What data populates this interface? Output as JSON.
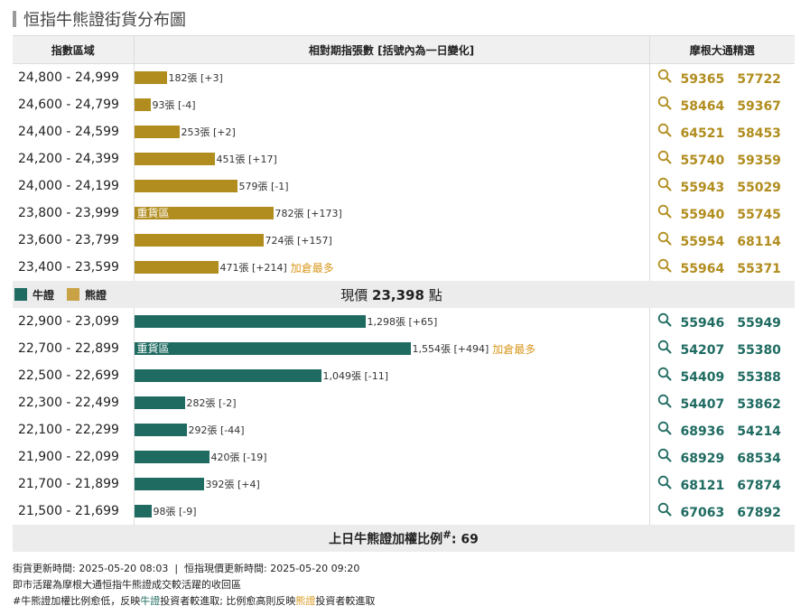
{
  "title": "恒指牛熊證街貨分布圖",
  "colors": {
    "bull": "#1f6b61",
    "bear": "#b18d1f",
    "hot": "#d9981e"
  },
  "header": {
    "col1": "指數區域",
    "col2": "相對期指張數 [括號內為一日變化]",
    "col3": "摩根大通精選"
  },
  "bear_rows": [
    {
      "range": "24,800 - 24,999",
      "qty": 182,
      "label": "182張 [+3]",
      "tag": "",
      "extra": "",
      "codes": [
        "59365",
        "57722"
      ]
    },
    {
      "range": "24,600 - 24,799",
      "qty": 93,
      "label": "93張 [-4]",
      "tag": "",
      "extra": "",
      "codes": [
        "58464",
        "59367"
      ]
    },
    {
      "range": "24,400 - 24,599",
      "qty": 253,
      "label": "253張 [+2]",
      "tag": "",
      "extra": "",
      "codes": [
        "64521",
        "58453"
      ]
    },
    {
      "range": "24,200 - 24,399",
      "qty": 451,
      "label": "451張 [+17]",
      "tag": "",
      "extra": "",
      "codes": [
        "55740",
        "59359"
      ]
    },
    {
      "range": "24,000 - 24,199",
      "qty": 579,
      "label": "579張 [-1]",
      "tag": "",
      "extra": "",
      "codes": [
        "55943",
        "55029"
      ]
    },
    {
      "range": "23,800 - 23,999",
      "qty": 782,
      "label": "782張 [+173]",
      "tag": "重貨區",
      "extra": "",
      "codes": [
        "55940",
        "55745"
      ]
    },
    {
      "range": "23,600 - 23,799",
      "qty": 724,
      "label": "724張 [+157]",
      "tag": "",
      "extra": "",
      "codes": [
        "55954",
        "68114"
      ]
    },
    {
      "range": "23,400 - 23,599",
      "qty": 471,
      "label": "471張 [+214]",
      "tag": "",
      "extra": "加倉最多",
      "codes": [
        "55964",
        "55371"
      ]
    }
  ],
  "legend": {
    "bull": "牛證",
    "bear": "熊證"
  },
  "price": {
    "label": "現價",
    "value": "23,398",
    "unit": "點"
  },
  "bull_rows": [
    {
      "range": "22,900 - 23,099",
      "qty": 1298,
      "label": "1,298張 [+65]",
      "tag": "",
      "extra": "",
      "codes": [
        "55946",
        "55949"
      ]
    },
    {
      "range": "22,700 - 22,899",
      "qty": 1554,
      "label": "1,554張 [+494]",
      "tag": "重貨區",
      "extra": "加倉最多",
      "codes": [
        "54207",
        "55380"
      ]
    },
    {
      "range": "22,500 - 22,699",
      "qty": 1049,
      "label": "1,049張 [-11]",
      "tag": "",
      "extra": "",
      "codes": [
        "54409",
        "55388"
      ]
    },
    {
      "range": "22,300 - 22,499",
      "qty": 282,
      "label": "282張 [-2]",
      "tag": "",
      "extra": "",
      "codes": [
        "54407",
        "53862"
      ]
    },
    {
      "range": "22,100 - 22,299",
      "qty": 292,
      "label": "292張 [-44]",
      "tag": "",
      "extra": "",
      "codes": [
        "68936",
        "54214"
      ]
    },
    {
      "range": "21,900 - 22,099",
      "qty": 420,
      "label": "420張 [-19]",
      "tag": "",
      "extra": "",
      "codes": [
        "68929",
        "68534"
      ]
    },
    {
      "range": "21,700 - 21,899",
      "qty": 392,
      "label": "392張 [+4]",
      "tag": "",
      "extra": "",
      "codes": [
        "68121",
        "67874"
      ]
    },
    {
      "range": "21,500 - 21,699",
      "qty": 98,
      "label": "98張 [-9]",
      "tag": "",
      "extra": "",
      "codes": [
        "67063",
        "67892"
      ]
    }
  ],
  "footer_ratio": {
    "label": "上日牛熊證加權比例",
    "mark": "#",
    "value": ": 69"
  },
  "notes": {
    "line1": "街貨更新時間: 2025-05-20 08:03  |  恒指現價更新時間: 2025-05-20 09:20",
    "line2": "即市活躍為摩根大通恒指牛熊證成交較活躍的收回區",
    "line3_a": "#牛熊證加權比例愈低，反映",
    "line3_b": "牛證",
    "line3_c": "投資者較進取; 比例愈高則反映",
    "line3_d": "熊證",
    "line3_e": "投資者較進取"
  }
}
